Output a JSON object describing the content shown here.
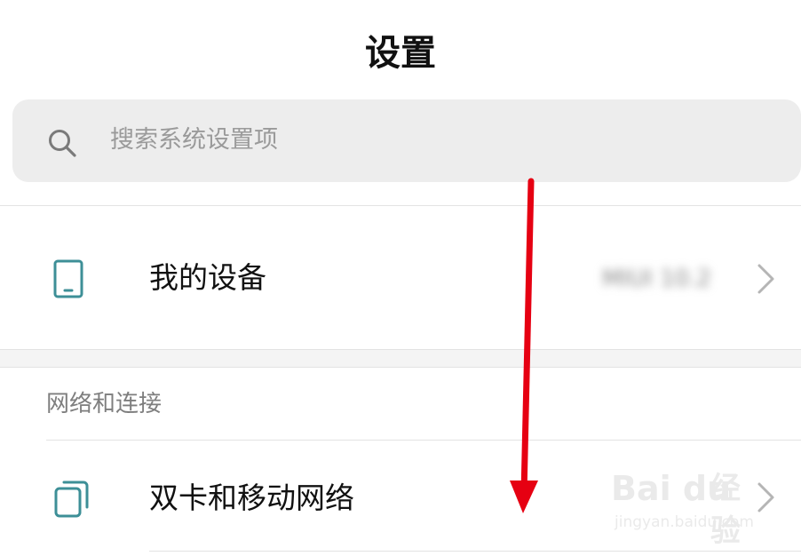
{
  "header": {
    "title": "设置"
  },
  "search": {
    "placeholder": "搜索系统设置项",
    "icon": "search-icon"
  },
  "device_row": {
    "label": "我的设备",
    "value": "MIUI 10.2",
    "icon": "phone-icon"
  },
  "network_section": {
    "header": "网络和连接",
    "items": [
      {
        "label": "双卡和移动网络",
        "icon": "dual-sim-icon"
      }
    ]
  },
  "watermark": {
    "logo_text": "Bai du",
    "logo_cn": "经验",
    "url": "jingyan.baidu.com"
  },
  "colors": {
    "accent_icon": "#3d8f97",
    "arrow": "#e60012",
    "search_bg": "#ededed"
  }
}
